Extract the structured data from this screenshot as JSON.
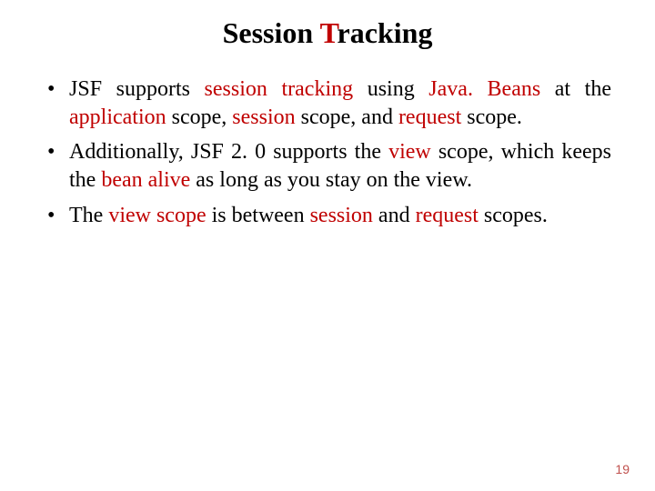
{
  "title": {
    "before": "Session ",
    "highlight": "T",
    "after": "racking"
  },
  "bullets": [
    {
      "segments": [
        {
          "t": "JSF supports ",
          "kw": false
        },
        {
          "t": "session tracking",
          "kw": true
        },
        {
          "t": " using ",
          "kw": false
        },
        {
          "t": "Java. Beans",
          "kw": true
        },
        {
          "t": " at the ",
          "kw": false
        },
        {
          "t": "application",
          "kw": true
        },
        {
          "t": " scope, ",
          "kw": false
        },
        {
          "t": "session",
          "kw": true
        },
        {
          "t": " scope, and ",
          "kw": false
        },
        {
          "t": "request",
          "kw": true
        },
        {
          "t": " scope.",
          "kw": false
        }
      ]
    },
    {
      "segments": [
        {
          "t": "Additionally, JSF 2. 0 supports the ",
          "kw": false
        },
        {
          "t": "view",
          "kw": true
        },
        {
          "t": " scope, which keeps the ",
          "kw": false
        },
        {
          "t": "bean alive",
          "kw": true
        },
        {
          "t": " as long as you stay on the view.",
          "kw": false
        }
      ]
    },
    {
      "segments": [
        {
          "t": "The ",
          "kw": false
        },
        {
          "t": "view scope",
          "kw": true
        },
        {
          "t": " is between ",
          "kw": false
        },
        {
          "t": "session",
          "kw": true
        },
        {
          "t": " and ",
          "kw": false
        },
        {
          "t": "request",
          "kw": true
        },
        {
          "t": " scopes.",
          "kw": false
        }
      ]
    }
  ],
  "page_number": "19"
}
